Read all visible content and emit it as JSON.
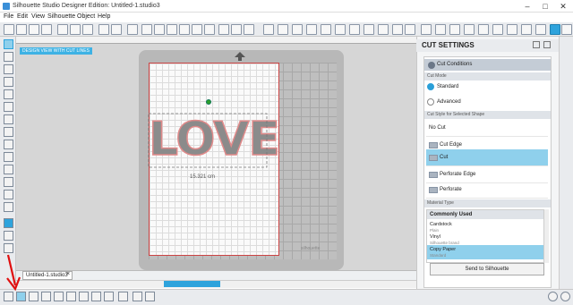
{
  "window": {
    "title": "Silhouette Studio Designer Edition: Untitled-1.studio3"
  },
  "menu": [
    "File",
    "Edit",
    "View",
    "Silhouette",
    "Object",
    "Help"
  ],
  "canvas": {
    "view_label": "DESIGN VIEW WITH CUT LINES",
    "design_text": "LOVE",
    "width_dimension": "15.321 cm",
    "mat_watermark": "silhouette",
    "document_tab": "Untitled-1.studio3"
  },
  "panel": {
    "title": "CUT SETTINGS",
    "cut_conditions": "Cut Conditions",
    "cut_mode_header": "Cut Mode",
    "cut_modes": [
      "Standard",
      "Advanced"
    ],
    "selected_mode": "Standard",
    "style_header": "Cut Style for Selected Shape",
    "cut_styles": [
      "No Cut",
      "Cut Edge",
      "Cut",
      "Perforate Edge",
      "Perforate"
    ],
    "selected_style": "Cut",
    "material_header": "Material Type",
    "material_group": "Commonly Used",
    "materials": [
      {
        "name": "Cardstock",
        "sub": "Plain"
      },
      {
        "name": "Vinyl",
        "sub": "Silhouette brand"
      },
      {
        "name": "Copy Paper",
        "sub": "Standard"
      }
    ],
    "send_button": "Send to Silhouette"
  },
  "colors": {
    "accent": "#2ea3dc",
    "selection": "#8fd0ec",
    "annotation_arrow": "#e01010"
  }
}
